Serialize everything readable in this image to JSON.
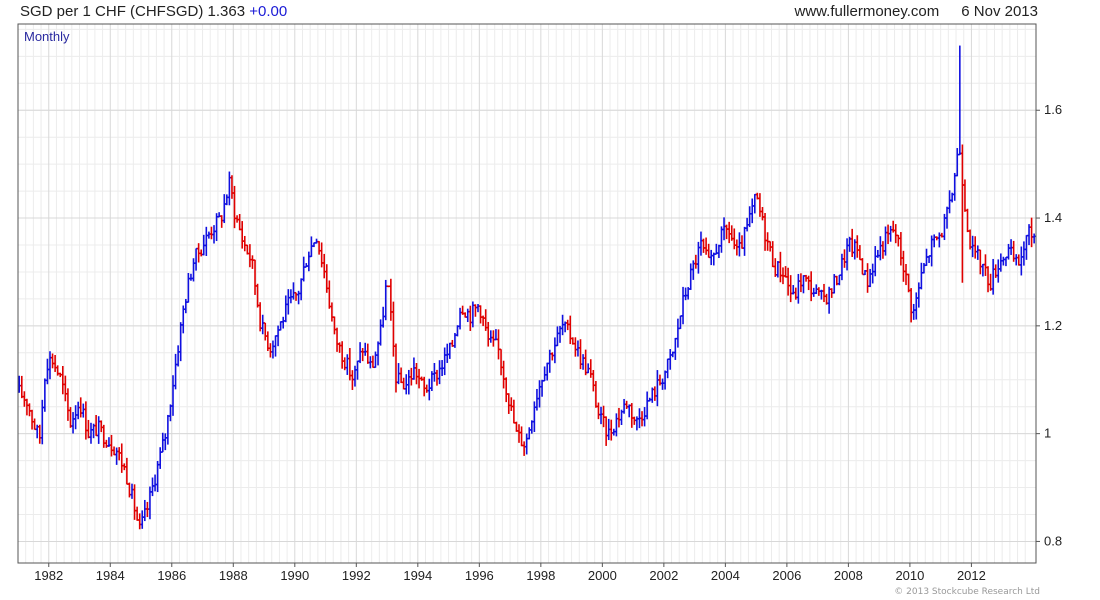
{
  "header": {
    "title": "SGD per 1 CHF (CHFSGD) 1.363",
    "change": "+0.00",
    "site": "www.fullermoney.com",
    "date": "6 Nov 2013"
  },
  "footer": {
    "credit": "© 2013 Stockcube Research Ltd"
  },
  "colors": {
    "up": "#1010e0",
    "down": "#e00000",
    "grid": "#d8d8d8",
    "frame": "#555555",
    "period_label": "#2a2aa0"
  },
  "chart_data": {
    "type": "ohlc-bar",
    "period_label": "Monthly",
    "ylim": [
      0.76,
      1.76
    ],
    "xlim": [
      1981.0,
      2014.1
    ],
    "y_ticks": [
      0.8,
      1,
      1.2,
      1.4,
      1.6
    ],
    "y_tick_labels": [
      "0.8",
      "1",
      "1.2",
      "1.4",
      "1.6"
    ],
    "x_ticks": [
      1982,
      1984,
      1986,
      1988,
      1990,
      1992,
      1994,
      1996,
      1998,
      2000,
      2002,
      2004,
      2006,
      2008,
      2010,
      2012
    ],
    "x_tick_labels": [
      "1982",
      "1984",
      "1986",
      "1988",
      "1990",
      "1992",
      "1994",
      "1996",
      "1998",
      "2000",
      "2002",
      "2004",
      "2006",
      "2008",
      "2010",
      "2012"
    ],
    "grid": true,
    "close_series": {
      "x": [
        1981.0,
        1981.3,
        1981.5,
        1981.7,
        1981.9,
        1982.1,
        1982.4,
        1982.7,
        1983.0,
        1983.3,
        1983.6,
        1983.9,
        1984.2,
        1984.5,
        1984.8,
        1984.95,
        1985.2,
        1985.5,
        1985.8,
        1986.1,
        1986.4,
        1986.7,
        1987.0,
        1987.3,
        1987.6,
        1987.9,
        1988.0,
        1988.3,
        1988.6,
        1988.9,
        1989.2,
        1989.5,
        1989.8,
        1990.1,
        1990.4,
        1990.7,
        1991.0,
        1991.3,
        1991.6,
        1991.9,
        1992.2,
        1992.5,
        1992.8,
        1993.0,
        1993.3,
        1993.6,
        1993.9,
        1994.2,
        1994.5,
        1994.8,
        1995.1,
        1995.4,
        1995.7,
        1996.0,
        1996.3,
        1996.6,
        1996.9,
        1997.2,
        1997.5,
        1997.8,
        1998.1,
        1998.4,
        1998.7,
        1999.0,
        1999.3,
        1999.6,
        1999.9,
        2000.2,
        2000.5,
        2000.8,
        2001.1,
        2001.4,
        2001.7,
        2002.0,
        2002.3,
        2002.6,
        2002.9,
        2003.2,
        2003.5,
        2003.8,
        2004.1,
        2004.4,
        2004.7,
        2005.0,
        2005.3,
        2005.6,
        2005.9,
        2006.2,
        2006.5,
        2006.8,
        2007.1,
        2007.4,
        2007.7,
        2008.0,
        2008.3,
        2008.6,
        2008.9,
        2009.2,
        2009.5,
        2009.8,
        2010.1,
        2010.4,
        2010.7,
        2011.0,
        2011.3,
        2011.6,
        2011.8,
        2012.0,
        2012.3,
        2012.6,
        2012.9,
        2013.2,
        2013.5,
        2013.85
      ],
      "values": [
        1.08,
        1.06,
        1.02,
        0.99,
        1.13,
        1.14,
        1.1,
        1.02,
        1.06,
        1.0,
        1.01,
        0.99,
        0.97,
        0.93,
        0.86,
        0.82,
        0.86,
        0.93,
        1.0,
        1.12,
        1.24,
        1.32,
        1.35,
        1.38,
        1.4,
        1.47,
        1.42,
        1.36,
        1.32,
        1.2,
        1.16,
        1.2,
        1.24,
        1.26,
        1.33,
        1.37,
        1.29,
        1.18,
        1.14,
        1.1,
        1.16,
        1.12,
        1.19,
        1.29,
        1.1,
        1.09,
        1.12,
        1.08,
        1.1,
        1.13,
        1.16,
        1.24,
        1.22,
        1.24,
        1.17,
        1.16,
        1.08,
        1.0,
        0.98,
        1.06,
        1.12,
        1.16,
        1.2,
        1.18,
        1.14,
        1.11,
        1.03,
        1.0,
        1.03,
        1.06,
        1.02,
        1.05,
        1.08,
        1.11,
        1.15,
        1.24,
        1.3,
        1.35,
        1.31,
        1.36,
        1.38,
        1.33,
        1.38,
        1.44,
        1.37,
        1.31,
        1.3,
        1.25,
        1.29,
        1.27,
        1.25,
        1.26,
        1.3,
        1.35,
        1.34,
        1.28,
        1.33,
        1.36,
        1.38,
        1.31,
        1.22,
        1.3,
        1.35,
        1.37,
        1.42,
        1.54,
        1.42,
        1.34,
        1.32,
        1.28,
        1.32,
        1.34,
        1.31,
        1.37
      ]
    }
  }
}
